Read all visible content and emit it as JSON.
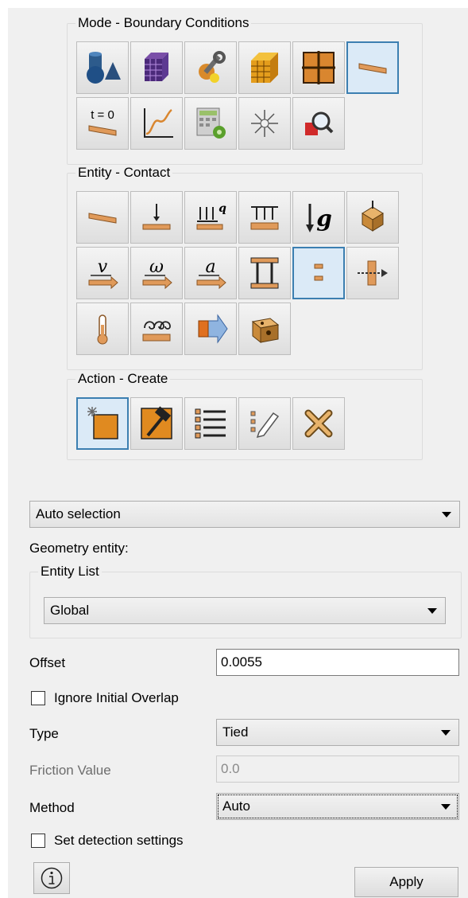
{
  "mode_group": {
    "legend": "Mode - Boundary Conditions",
    "buttons": [
      {
        "icon": "geometry-shapes-icon",
        "active": false
      },
      {
        "icon": "mesh-cube-icon",
        "active": false
      },
      {
        "icon": "material-tools-icon",
        "active": false
      },
      {
        "icon": "meshed-block-icon",
        "active": false
      },
      {
        "icon": "grid-frame-icon",
        "active": false
      },
      {
        "icon": "boundary-plate-icon",
        "active": true
      },
      {
        "icon": "initial-condition-icon",
        "active": false,
        "text": "t = 0"
      },
      {
        "icon": "function-curve-icon",
        "active": false
      },
      {
        "icon": "calculator-settings-icon",
        "active": false
      },
      {
        "icon": "spark-icon",
        "active": false
      },
      {
        "icon": "magnify-inspect-icon",
        "active": false
      }
    ]
  },
  "entity_group": {
    "legend": "Entity - Contact",
    "buttons": [
      {
        "icon": "plate-icon",
        "active": false
      },
      {
        "icon": "point-load-icon",
        "active": false
      },
      {
        "icon": "distributed-load-icon",
        "active": false,
        "text": "q"
      },
      {
        "icon": "pressure-icon",
        "active": false
      },
      {
        "icon": "gravity-icon",
        "active": false,
        "text": "g"
      },
      {
        "icon": "body-force-icon",
        "active": false
      },
      {
        "icon": "velocity-icon",
        "active": false,
        "text": "v"
      },
      {
        "icon": "angular-velocity-icon",
        "active": false,
        "text": "ω"
      },
      {
        "icon": "acceleration-icon",
        "active": false,
        "text": "a"
      },
      {
        "icon": "tied-pair-icon",
        "active": false
      },
      {
        "icon": "contact-icon",
        "active": true
      },
      {
        "icon": "rigid-link-icon",
        "active": false
      },
      {
        "icon": "temperature-icon",
        "active": false
      },
      {
        "icon": "convection-icon",
        "active": false
      },
      {
        "icon": "flux-icon",
        "active": false
      },
      {
        "icon": "volume-cube-icon",
        "active": false
      }
    ]
  },
  "action_group": {
    "legend": "Action - Create",
    "buttons": [
      {
        "icon": "create-new-icon",
        "active": true
      },
      {
        "icon": "modify-hammer-icon",
        "active": false
      },
      {
        "icon": "list-icon",
        "active": false
      },
      {
        "icon": "edit-pencil-icon",
        "active": false
      },
      {
        "icon": "delete-icon",
        "active": false
      }
    ]
  },
  "form": {
    "selection_mode": "Auto selection",
    "geometry_entity_label": "Geometry entity:",
    "entity_list_legend": "Entity List",
    "entity_list_value": "Global",
    "offset_label": "Offset",
    "offset_value": "0.0055",
    "ignore_overlap_label": "Ignore Initial Overlap",
    "type_label": "Type",
    "type_value": "Tied",
    "friction_label": "Friction Value",
    "friction_value": "0.0",
    "method_label": "Method",
    "method_value": "Auto",
    "detection_label": "Set detection settings",
    "apply_label": "Apply"
  },
  "colors": {
    "active_border": "#3c7fb1",
    "active_bg": "#dbeaf7",
    "plate_orange": "#e09a5a",
    "panel_bg": "#f0f0f0"
  }
}
